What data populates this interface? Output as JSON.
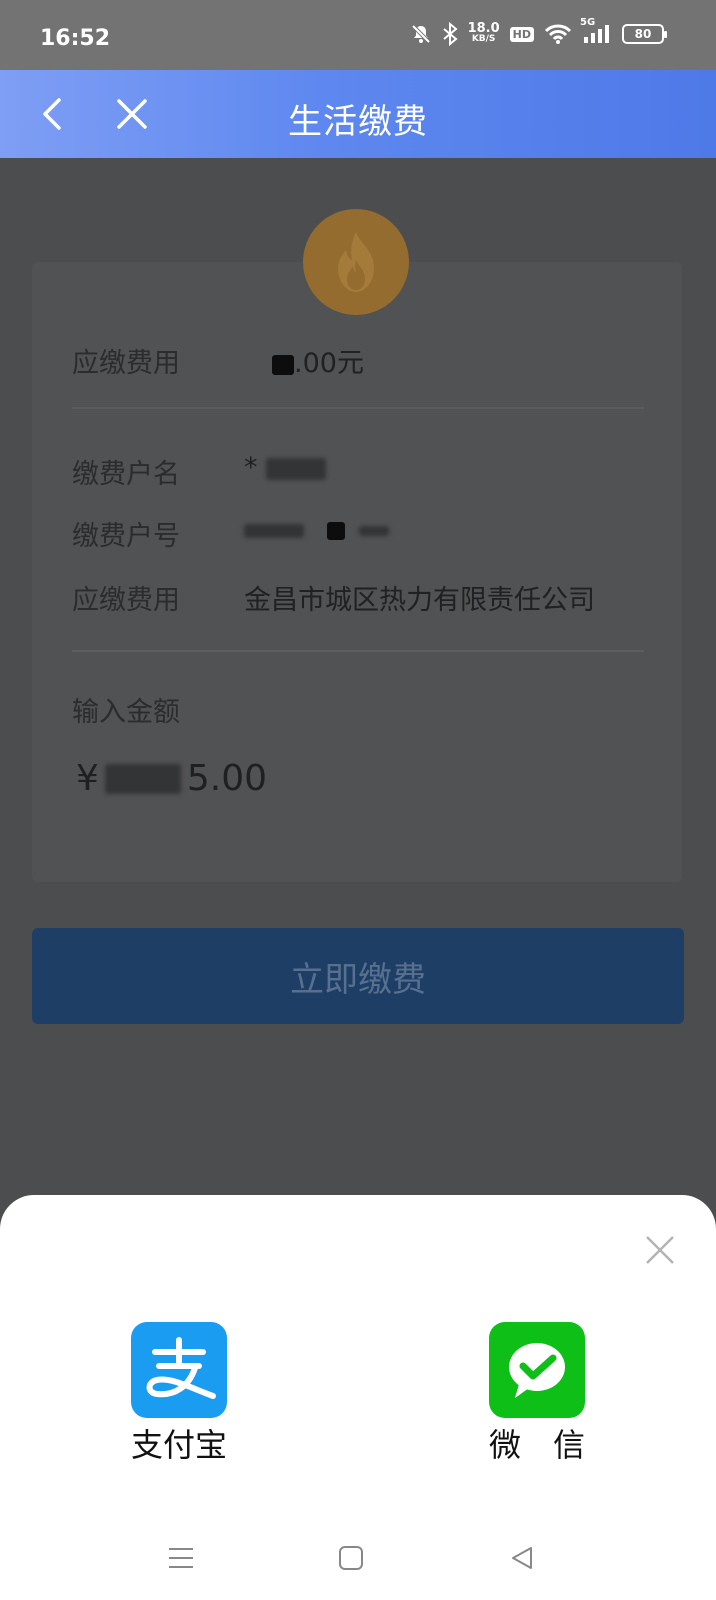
{
  "status_bar": {
    "time": "16:52",
    "net_speed_value": "18.0",
    "net_speed_unit": "KB/S",
    "hd_label": "HD",
    "network_label": "5G",
    "battery": "80"
  },
  "header": {
    "title": "生活缴费"
  },
  "bill": {
    "due_label": "应缴费用",
    "due_value_suffix": ".00元",
    "account_name_label": "缴费户名",
    "account_name_prefix": "*",
    "account_no_label": "缴费户号",
    "company_label": "应缴费用",
    "company_value": "金昌市城区热力有限责任公司",
    "input_label": "输入金额",
    "currency_symbol": "¥",
    "amount_suffix": "5.00"
  },
  "pay_button": {
    "label": "立即缴费"
  },
  "payment_sheet": {
    "options": [
      {
        "label": "支付宝",
        "icon": "alipay-icon",
        "color": "#1a9df0"
      },
      {
        "label": "微　信",
        "icon": "wechat-icon",
        "color": "#0dbf17"
      }
    ]
  },
  "colors": {
    "header_gradient_start": "#7f9ef5",
    "header_gradient_end": "#4e79e8",
    "overlay": "#4b4d4e",
    "flame_icon": "#946c2f"
  }
}
